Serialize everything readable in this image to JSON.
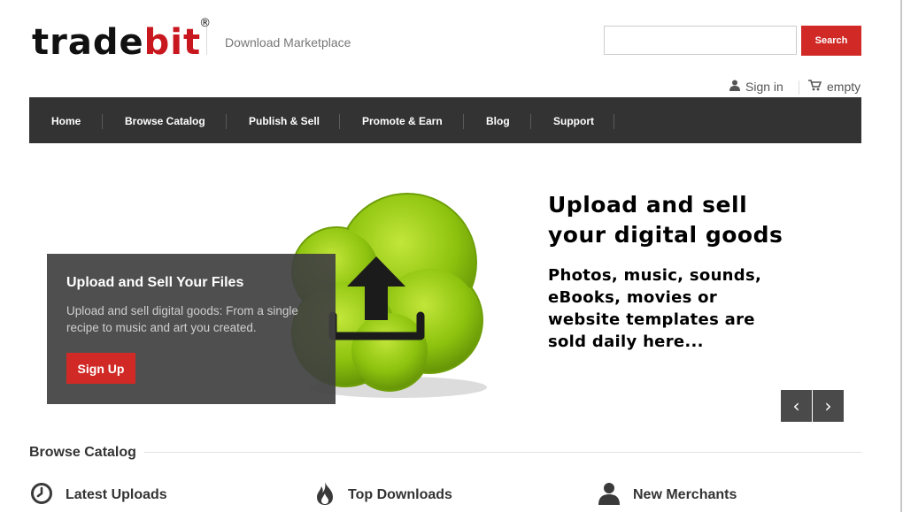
{
  "header": {
    "logo_part1": "trade",
    "logo_part2": "bit",
    "logo_reg": "®",
    "tagline": "Download Marketplace"
  },
  "search": {
    "value": "",
    "placeholder": "",
    "button_label": "Search"
  },
  "utility": {
    "signin_label": "Sign in",
    "cart_label": "empty"
  },
  "nav": {
    "items": [
      {
        "label": "Home"
      },
      {
        "label": "Browse Catalog"
      },
      {
        "label": "Publish & Sell"
      },
      {
        "label": "Promote & Earn"
      },
      {
        "label": "Blog"
      },
      {
        "label": "Support"
      }
    ]
  },
  "hero": {
    "box_title": "Upload and Sell Your Files",
    "box_text": "Upload and sell digital goods: From a single recipe to music and art you created.",
    "signup_label": "Sign Up",
    "title_line1": "Upload and sell",
    "title_line2": "your digital goods",
    "sub_line1": "Photos, music, sounds,",
    "sub_line2": "eBooks, movies or",
    "sub_line3": "website templates are",
    "sub_line4": "sold daily here...",
    "prev_symbol": "‹",
    "next_symbol": "›"
  },
  "browse": {
    "title": "Browse Catalog",
    "categories": [
      {
        "label": "Latest Uploads",
        "icon": "clock-icon"
      },
      {
        "label": "Top Downloads",
        "icon": "flame-icon"
      },
      {
        "label": "New Merchants",
        "icon": "person-icon"
      }
    ]
  },
  "colors": {
    "accent_red": "#d12a26",
    "nav_bg": "#333333",
    "cloud_green": "#8cc20e"
  }
}
